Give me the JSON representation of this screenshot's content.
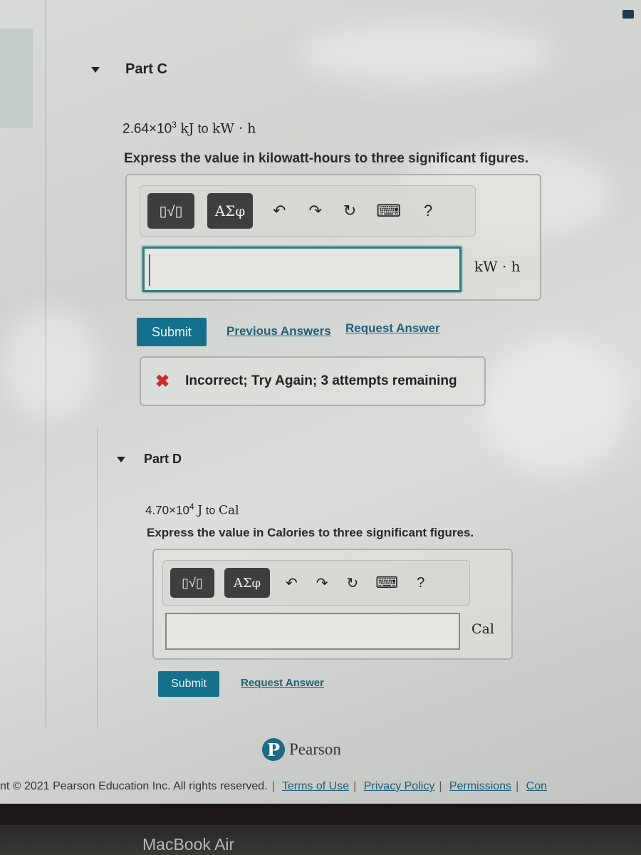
{
  "partC": {
    "title": "Part C",
    "problem": {
      "value": "2.64×10",
      "exponent": "3",
      "from_unit": "kJ",
      "to_word": "to",
      "to_unit": "kW · h"
    },
    "instruction": "Express the value in kilowatt-hours to three significant figures.",
    "toolbar": {
      "templates_label": "▯√▯",
      "greek_label": "ΑΣφ",
      "undo_icon": "↶",
      "redo_icon": "↷",
      "reset_icon": "↻",
      "keyboard_icon": "⌨",
      "help_label": "?"
    },
    "answer": {
      "value": "",
      "unit": "kW · h"
    },
    "submit_label": "Submit",
    "previous_answers_label": "Previous Answers",
    "request_answer_label": "Request Answer",
    "feedback": {
      "icon": "✖",
      "text": "Incorrect; Try Again; 3 attempts remaining"
    }
  },
  "partD": {
    "title": "Part D",
    "problem": {
      "value": "4.70×10",
      "exponent": "4",
      "from_unit": "J",
      "to_word": "to",
      "to_unit": "Cal"
    },
    "instruction": "Express the value in Calories to three significant figures.",
    "toolbar": {
      "templates_label": "▯√▯",
      "greek_label": "ΑΣφ",
      "undo_icon": "↶",
      "redo_icon": "↷",
      "reset_icon": "↻",
      "keyboard_icon": "⌨",
      "help_label": "?"
    },
    "answer": {
      "value": "",
      "unit": "Cal"
    },
    "submit_label": "Submit",
    "request_answer_label": "Request Answer"
  },
  "brand": {
    "logo_letter": "P",
    "name": "Pearson"
  },
  "footer": {
    "copyright": "nt © 2021 Pearson Education Inc. All rights reserved.",
    "links": [
      "Terms of Use",
      "Privacy Policy",
      "Permissions",
      "Con"
    ]
  },
  "device": {
    "label": "MacBook Air"
  }
}
